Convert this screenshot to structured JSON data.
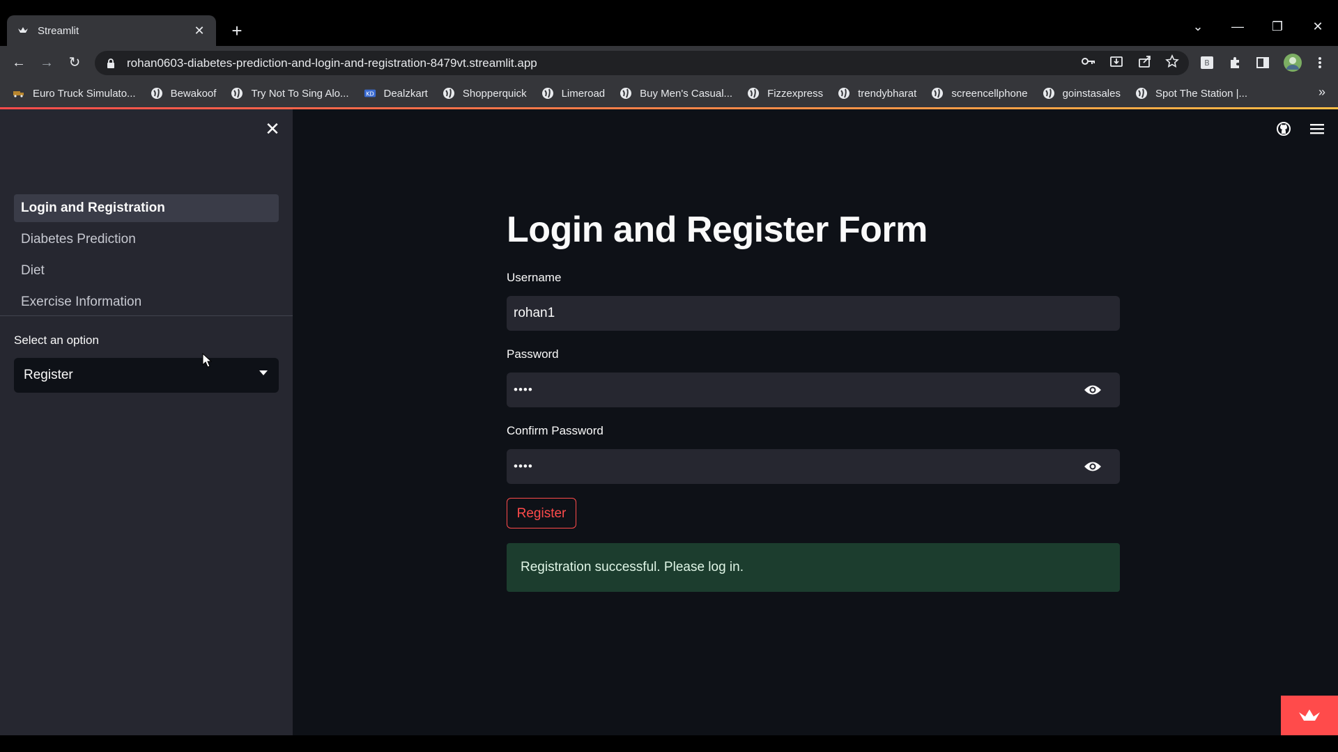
{
  "browser": {
    "tab_title": "Streamlit",
    "url": "rohan0603-diabetes-prediction-and-login-and-registration-8479vt.streamlit.app",
    "bookmarks": [
      "Euro Truck Simulato...",
      "Bewakoof",
      "Try Not To Sing Alo...",
      "Dealzkart",
      "Shopperquick",
      "Limeroad",
      "Buy Men's Casual...",
      "Fizzexpress",
      "trendybharat",
      "screencellphone",
      "goinstasales",
      "Spot The Station |..."
    ],
    "more_bookmarks": "»",
    "accent": "#ff4b4b"
  },
  "sidebar": {
    "nav_items": [
      "Login and Registration",
      "Diabetes Prediction",
      "Diet",
      "Exercise Information"
    ],
    "active_item": "Login and Registration",
    "select_label": "Select an option",
    "select_value": "Register"
  },
  "main": {
    "title": "Login and Register Form",
    "username_label": "Username",
    "username_value": "rohan1",
    "password_label": "Password",
    "password_value": "••••",
    "confirm_label": "Confirm Password",
    "confirm_value": "••••",
    "register_button": "Register",
    "success_message": "Registration successful. Please log in."
  },
  "icons": {
    "tab_favicon": "streamlit-crown-icon",
    "github": "github-icon",
    "menu": "hamburger-menu-icon",
    "password_toggle": "eye-icon"
  }
}
